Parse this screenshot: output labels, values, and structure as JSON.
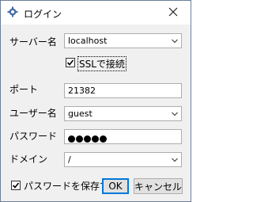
{
  "window": {
    "title": "ログイン"
  },
  "server": {
    "label": "サーバー名",
    "value": "localhost"
  },
  "ssl": {
    "label": "SSLで接続",
    "checked": true
  },
  "port": {
    "label": "ポート",
    "value": "21382"
  },
  "user": {
    "label": "ユーザー名",
    "value": "guest"
  },
  "password": {
    "label": "パスワード",
    "masked_length": 5
  },
  "domain": {
    "label": "ドメイン",
    "value": "/"
  },
  "save_password": {
    "label": "パスワードを保存する",
    "checked": true
  },
  "buttons": {
    "ok": "OK",
    "cancel": "キャンセル"
  },
  "icons": {
    "app": "gear-icon",
    "close": "close-icon",
    "dropdown": "chevron-down-icon"
  }
}
